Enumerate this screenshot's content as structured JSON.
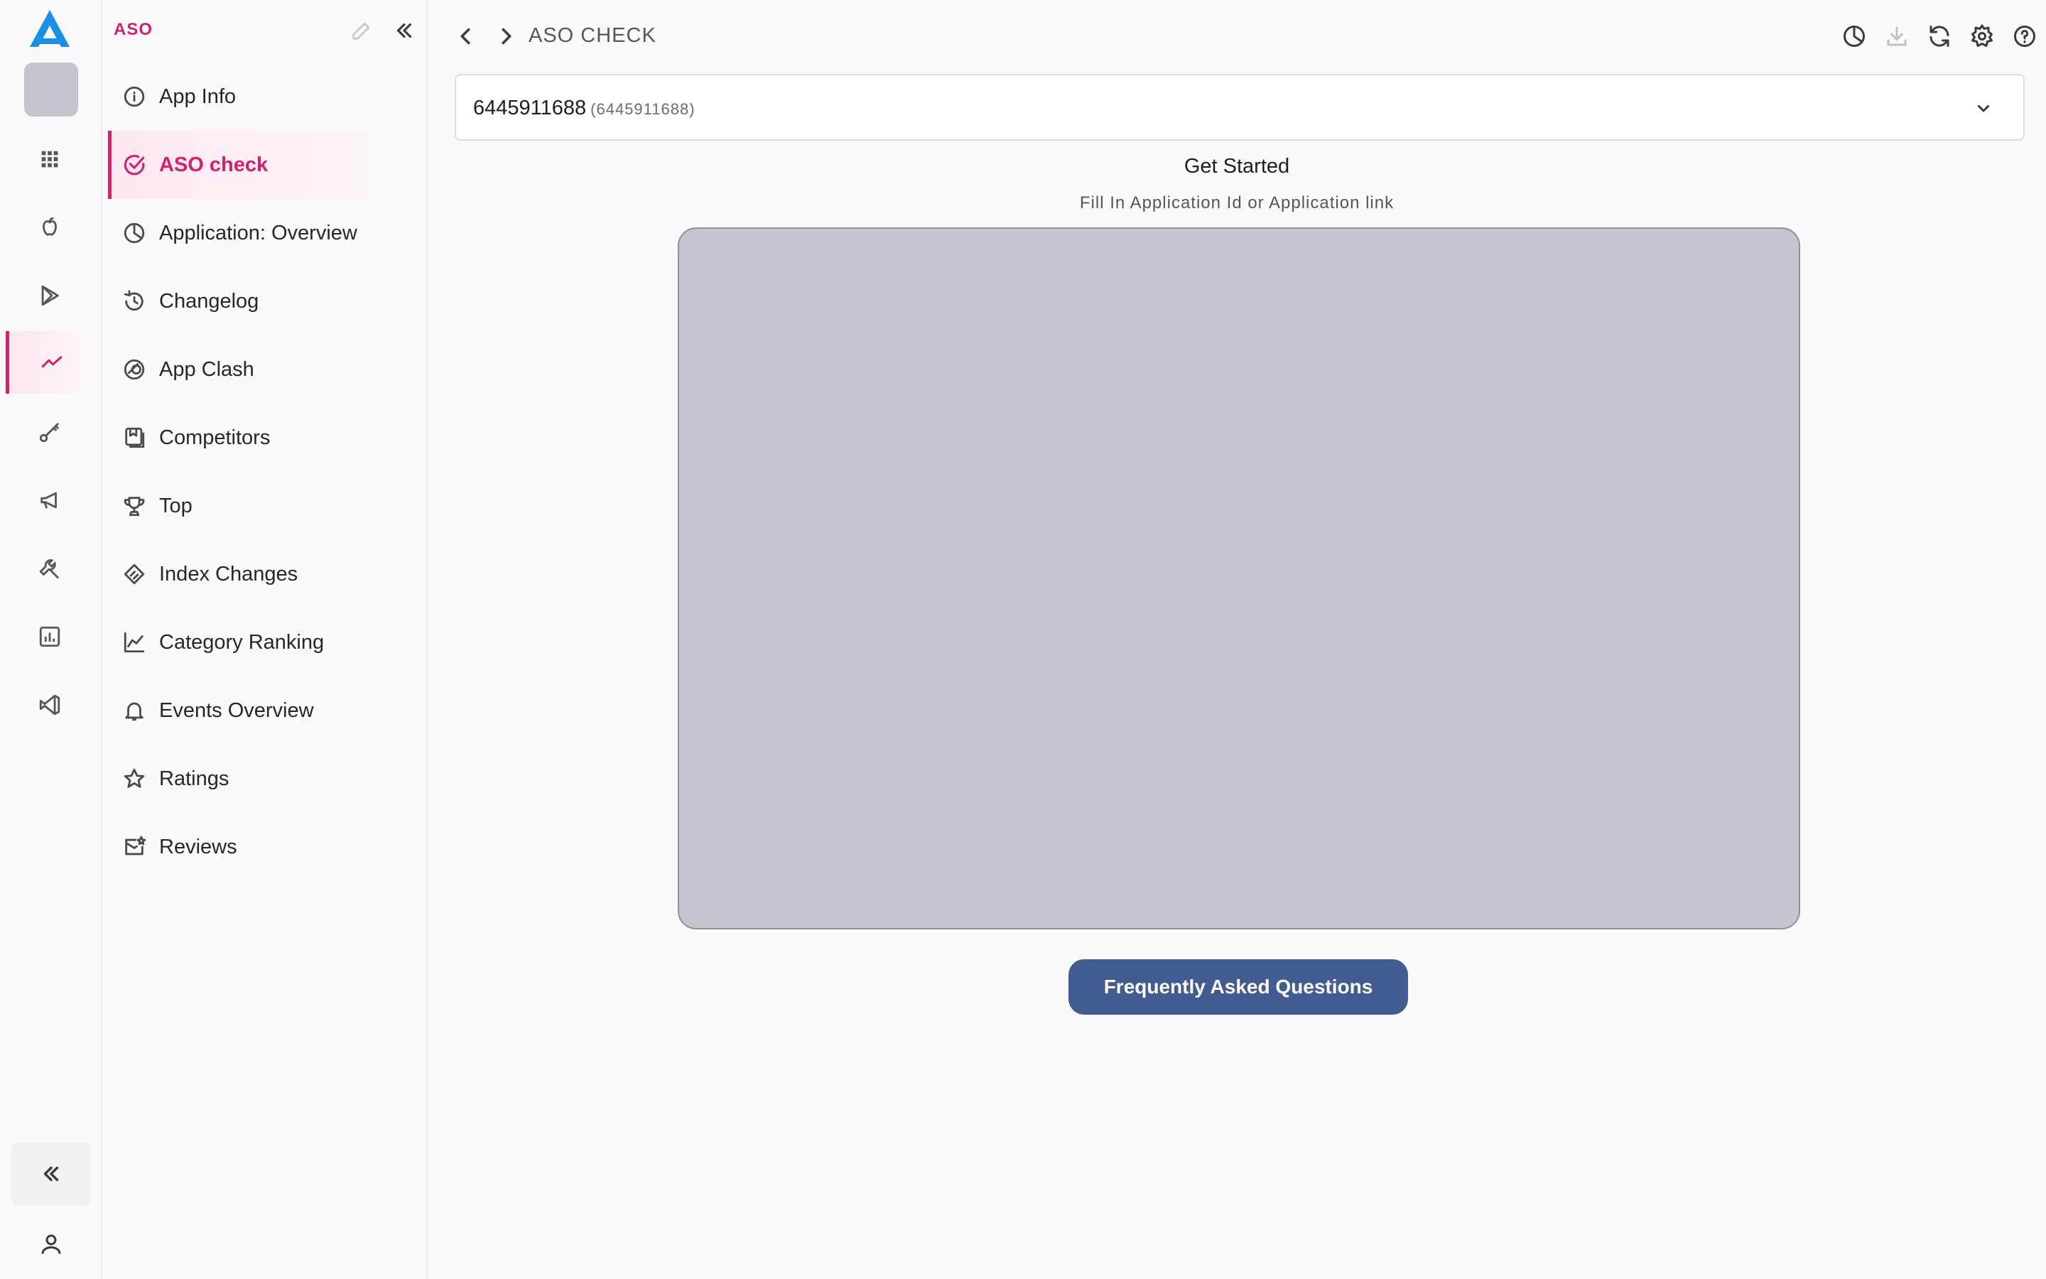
{
  "colors": {
    "accent": "#d2226d",
    "primary_button": "#425b91",
    "placeholder": "#c4c6ce"
  },
  "rail": {
    "items": [
      {
        "icon": "grid-icon"
      },
      {
        "icon": "apple-icon"
      },
      {
        "icon": "google-play-icon"
      },
      {
        "icon": "aso-trend-icon",
        "active": true
      },
      {
        "icon": "key-icon"
      },
      {
        "icon": "megaphone-icon"
      },
      {
        "icon": "tools-icon"
      },
      {
        "icon": "report-chart-icon"
      },
      {
        "icon": "vscode-icon"
      }
    ]
  },
  "sidebar": {
    "section_title": "ASO",
    "items": [
      {
        "label": "App Info",
        "icon": "info-icon"
      },
      {
        "label": "ASO check",
        "icon": "check-circle-icon",
        "active": true
      },
      {
        "label": "Application: Overview",
        "icon": "pie-chart-icon"
      },
      {
        "label": "Changelog",
        "icon": "history-icon"
      },
      {
        "label": "App Clash",
        "icon": "clash-circles-icon"
      },
      {
        "label": "Competitors",
        "icon": "competitors-icon"
      },
      {
        "label": "Top",
        "icon": "trophy-icon"
      },
      {
        "label": "Index Changes",
        "icon": "index-changes-icon"
      },
      {
        "label": "Category Ranking",
        "icon": "line-chart-icon"
      },
      {
        "label": "Events Overview",
        "icon": "bell-icon"
      },
      {
        "label": "Ratings",
        "icon": "star-icon"
      },
      {
        "label": "Reviews",
        "icon": "reviews-icon"
      }
    ]
  },
  "header": {
    "breadcrumb": "ASO CHECK"
  },
  "app_select": {
    "value": "6445911688",
    "sub": "(6445911688)"
  },
  "main": {
    "title": "Get Started",
    "subtitle": "Fill In Application Id or Application link",
    "faq_label": "Frequently Asked Questions"
  }
}
